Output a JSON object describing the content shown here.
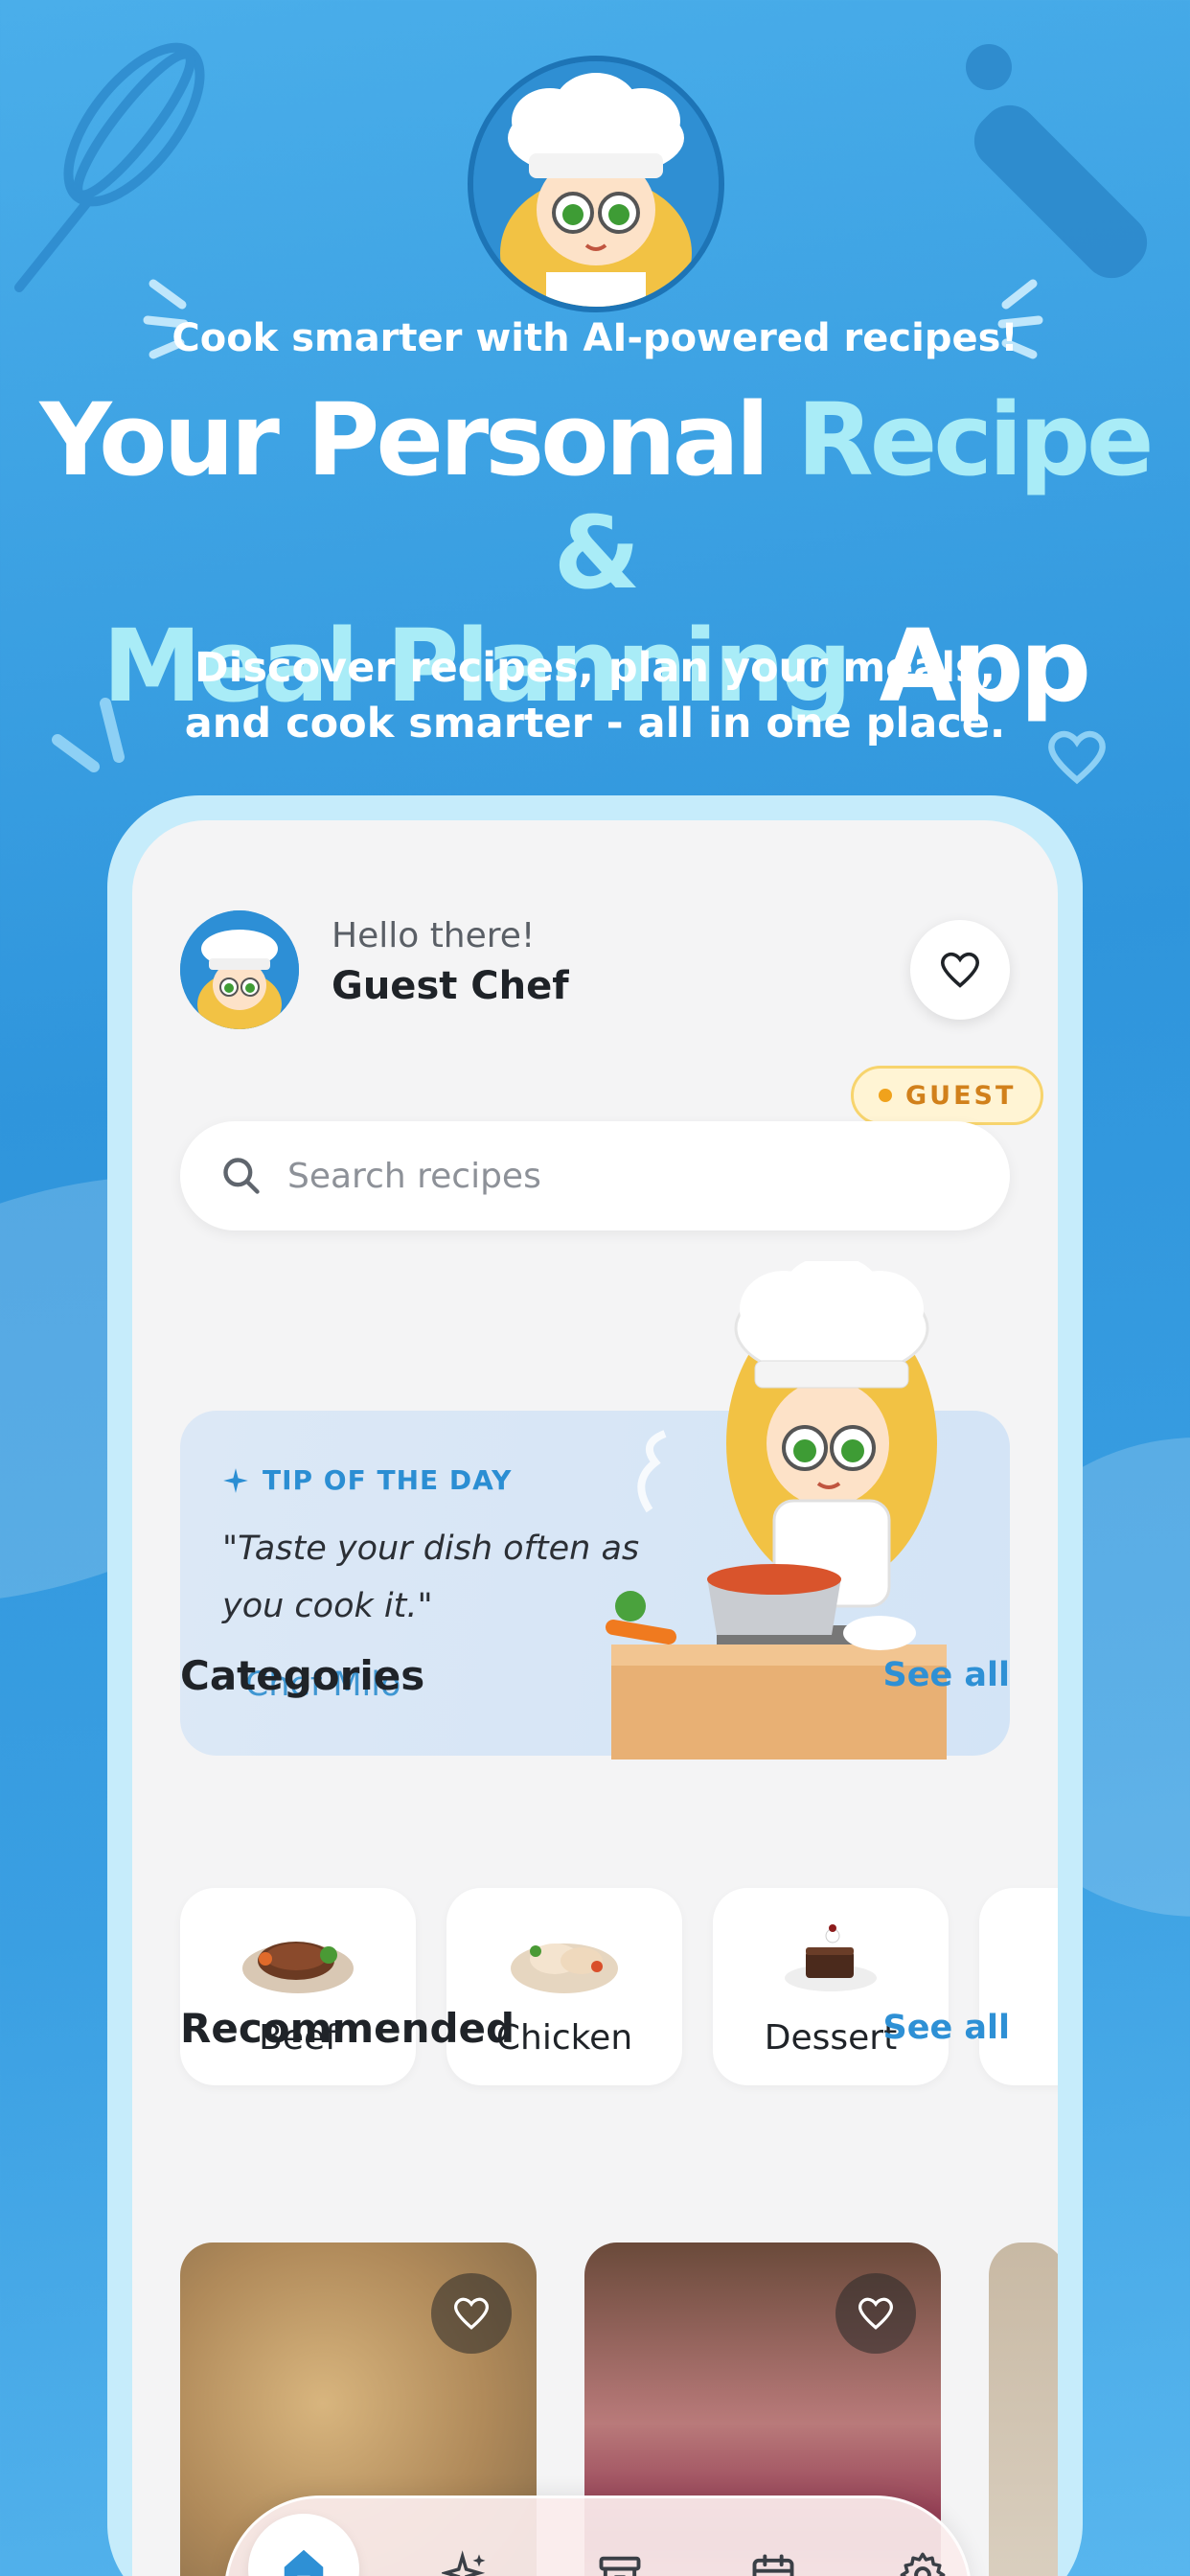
{
  "hero": {
    "tagline": "Cook smarter with AI-powered recipes!",
    "headline_part1": "Your Personal",
    "headline_accent1": "Recipe &",
    "headline_accent2": "Meal Planning",
    "headline_part2": "App",
    "subhead_line1": "Discover recipes, plan your meals,",
    "subhead_line2": "and cook smarter - all in one place."
  },
  "header": {
    "greeting": "Hello there!",
    "user_name": "Guest Chef",
    "badge": "GUEST"
  },
  "search": {
    "placeholder": "Search recipes"
  },
  "tip": {
    "label": "TIP OF THE DAY",
    "quote": "\"Taste your dish often as you cook it.\"",
    "author": "- Chef Milo"
  },
  "categories": {
    "title": "Categories",
    "see_all": "See all",
    "items": [
      {
        "label": "Beef",
        "icon": "beef-dish-icon"
      },
      {
        "label": "Chicken",
        "icon": "chicken-dish-icon"
      },
      {
        "label": "Dessert",
        "icon": "dessert-dish-icon"
      }
    ]
  },
  "recommended": {
    "title": "Recommended",
    "see_all": "See all"
  },
  "nav": {
    "items": [
      {
        "icon": "home-icon",
        "active": true
      },
      {
        "icon": "sparkles-icon",
        "active": false
      },
      {
        "icon": "archive-icon",
        "active": false
      },
      {
        "icon": "calendar-icon",
        "active": false
      },
      {
        "icon": "settings-icon",
        "active": false
      }
    ]
  },
  "colors": {
    "background": "#3a9fe2",
    "accent_text": "#a9ecf7",
    "link": "#2e90d5",
    "badge_text": "#d1801b",
    "nav_active": "#2e90d5"
  }
}
